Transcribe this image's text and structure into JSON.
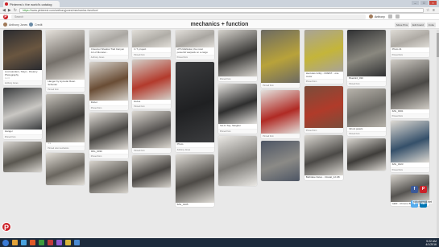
{
  "browser": {
    "tab_title": "Pinterest • the world's catalog",
    "url_secure": "https://",
    "url_rest": "www.pinterest.com/anthonyjones/mechanics-function/",
    "controls": [
      "–",
      "□",
      "×"
    ]
  },
  "header": {
    "search_placeholder": "Search",
    "user_name": "Anthony",
    "icons": [
      "search-icon",
      "notifications-icon",
      "settings-icon"
    ]
  },
  "board": {
    "owner": "Anthony Jones",
    "owner_tag": "Credit",
    "title": "mechanics + function",
    "actions": [
      "Move Pins",
      "Edit board",
      "Invite"
    ]
  },
  "columns": [
    [
      {
        "h": 50,
        "c1": "#2a2b30",
        "c2": "#6a5640",
        "desc": "Lost wanders, Tokyo - Dreamy Photography",
        "meta": "1 ♥ 3",
        "src": "Anthony Jones"
      },
      {
        "h": 52,
        "c1": "#3a3c3e",
        "c2": "#c9c7c3",
        "desc": "Hanger",
        "meta": "",
        "src": "Pinned from"
      },
      {
        "h": 38,
        "c1": "#d9d6d1",
        "c2": "#5a5750",
        "desc": "",
        "meta": "",
        "src": ""
      }
    ],
    [
      {
        "h": 62,
        "c1": "#e6e2dc",
        "c2": "#75706a",
        "desc": "Hanger by Hymolar Roan Schuster",
        "meta": "",
        "src": "Pinned from"
      },
      {
        "h": 60,
        "c1": "#c9c5bd",
        "c2": "#3d3b38",
        "desc": "",
        "meta": "1 ♥",
        "src": "Pinned onto mechanics"
      },
      {
        "h": 40,
        "c1": "#e1ddd6",
        "c2": "#6a665f",
        "desc": "",
        "meta": "",
        "src": ""
      }
    ],
    [
      {
        "h": 22,
        "c1": "#dcdad6",
        "c2": "#aaa7a2",
        "desc": "Chestnut Shadow Trail Canyon Art of Monster...",
        "meta": "",
        "src": "Anthony Jones"
      },
      {
        "h": 48,
        "c1": "#d6d2cb",
        "c2": "#6a4d35",
        "desc": "Robot",
        "meta": "",
        "src": "Pinned from"
      },
      {
        "h": 46,
        "c1": "#e0dcd6",
        "c2": "#4a4845",
        "desc": "IMG_0030",
        "meta": "",
        "src": "Pinned from"
      },
      {
        "h": 40,
        "c1": "#d8d4cd",
        "c2": "#5d5a55",
        "desc": "",
        "meta": "",
        "src": ""
      }
    ],
    [
      {
        "h": 22,
        "c1": "#e2dfd9",
        "c2": "#b0ada7",
        "desc": "C.T. project",
        "meta": "",
        "src": "Pinned from"
      },
      {
        "h": 50,
        "c1": "#d3cfc8",
        "c2": "#b33a2c",
        "desc": "Robot",
        "meta": "",
        "src": "Pinned from"
      },
      {
        "h": 46,
        "c1": "#dbd7d0",
        "c2": "#555250",
        "desc": "",
        "meta": "",
        "src": "Pinned from"
      },
      {
        "h": 40,
        "c1": "#d5d1ca",
        "c2": "#4a4744",
        "desc": "",
        "meta": "",
        "src": ""
      }
    ],
    [
      {
        "h": 22,
        "c1": "#e3e0db",
        "c2": "#a9a6a1",
        "desc": "HTS Mahkolar, the most powerful warpack on a cargo",
        "meta": "",
        "src": "Pinned from"
      },
      {
        "h": 100,
        "c1": "#3c3d3f",
        "c2": "#1f2022",
        "desc": "Photo",
        "meta": "",
        "src": "Anthony Jones"
      },
      {
        "h": 60,
        "c1": "#dedbd5",
        "c2": "#4d4a46",
        "desc": "IMG_0105",
        "meta": "",
        "src": ""
      }
    ],
    [
      {
        "h": 58,
        "c1": "#d6d3cd",
        "c2": "#3a3937",
        "desc": "",
        "meta": "",
        "src": "Pinned from"
      },
      {
        "h": 50,
        "c1": "#e3e1dd",
        "c2": "#2e2e2e",
        "desc": "Sci-Fi Top, Sleigher",
        "meta": "",
        "src": "Pinned from"
      },
      {
        "h": 62,
        "c1": "#ebe9e5",
        "c2": "#7a7874",
        "desc": "",
        "meta": "",
        "src": ""
      }
    ],
    [
      {
        "h": 66,
        "c1": "#6c6a63",
        "c2": "#b8a23a",
        "desc": "",
        "meta": "",
        "src": "Pinned from"
      },
      {
        "h": 54,
        "c1": "#e3e1dd",
        "c2": "#b02a24",
        "desc": "",
        "meta": "",
        "src": "Pinned from"
      },
      {
        "h": 50,
        "c1": "#4d5564",
        "c2": "#8b8a86",
        "desc": "",
        "meta": "",
        "src": ""
      }
    ],
    [
      {
        "h": 52,
        "c1": "#a8a398",
        "c2": "#c4b53a",
        "desc": "Hercules Gritty - CREST... one motor",
        "meta": "",
        "src": "Pinned from"
      },
      {
        "h": 52,
        "c1": "#7a4d3b",
        "c2": "#b03b2a",
        "desc": "",
        "meta": "",
        "src": "Pinned from"
      },
      {
        "h": 50,
        "c1": "#dad7d1",
        "c2": "#4b4946",
        "desc": "Bathtake Delex... Rostal_12 AB",
        "meta": "",
        "src": ""
      }
    ],
    [
      {
        "h": 58,
        "c1": "#2f3032",
        "c2": "#8a887f",
        "desc": "Bluebird_030",
        "meta": "",
        "src": "Pinned from"
      },
      {
        "h": 48,
        "c1": "#b7b3ab",
        "c2": "#6d6b66",
        "desc": "Ghost jewels",
        "meta": "",
        "src": "Pinned from"
      },
      {
        "h": 40,
        "c1": "#d9d6d0",
        "c2": "#3f3d3a",
        "desc": "",
        "meta": "",
        "src": ""
      }
    ],
    [
      {
        "h": 22,
        "c1": "#dfdcd6",
        "c2": "#aeaaa4",
        "desc": "Photo 41",
        "meta": "",
        "src": "Pinned from"
      },
      {
        "h": 62,
        "c1": "#d1cdc6",
        "c2": "#4a4845",
        "desc": "IMG_0001",
        "meta": "",
        "src": "Pinned from"
      },
      {
        "h": 52,
        "c1": "#dedad3",
        "c2": "#35506a",
        "desc": "IMG_0023",
        "meta": "",
        "src": "Pinned from"
      },
      {
        "h": 34,
        "c1": "#d8d4cd",
        "c2": "#555350",
        "desc": "GEM - Chrome Bot Furniture",
        "meta": "",
        "src": ""
      }
    ]
  ],
  "social": [
    {
      "label": "f",
      "color": "#3b5998",
      "name": "facebook-icon"
    },
    {
      "label": "P",
      "color": "#cb2027",
      "name": "pinterest-icon"
    },
    {
      "label": "t",
      "color": "#55acee",
      "name": "twitter-icon"
    },
    {
      "label": "in",
      "color": "#0077b5",
      "name": "linkedin-icon"
    }
  ],
  "watermark": "robotpencil.net",
  "taskbar": {
    "time": "9:22 AM",
    "date": "4/1/2016",
    "apps": [
      "#e2a33a",
      "#4aa3df",
      "#e05a2a",
      "#3c9a3c",
      "#c13a3a",
      "#8e5ad1",
      "#d7b53a",
      "#4a8ad1"
    ]
  }
}
